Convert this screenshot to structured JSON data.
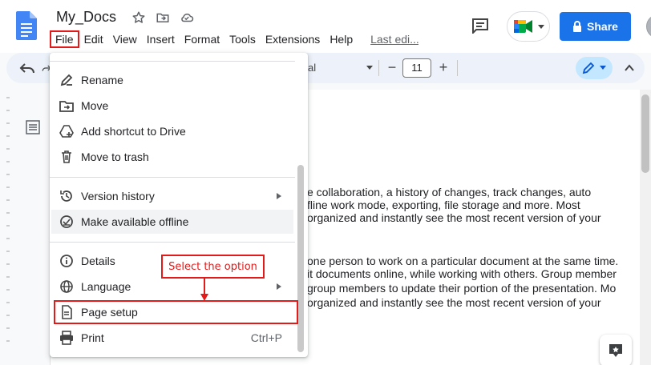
{
  "header": {
    "doc_title": "My_Docs",
    "share_label": "Share",
    "last_edit": "Last edi..."
  },
  "menubar": {
    "items": [
      "File",
      "Edit",
      "View",
      "Insert",
      "Format",
      "Tools",
      "Extensions",
      "Help"
    ]
  },
  "toolbar": {
    "font_name": "al",
    "font_size": "11",
    "minus": "−",
    "plus": "+"
  },
  "file_menu": {
    "items": [
      {
        "label": "Rename",
        "icon": "rename-icon"
      },
      {
        "label": "Move",
        "icon": "move-icon"
      },
      {
        "label": "Add shortcut to Drive",
        "icon": "add-shortcut-icon"
      },
      {
        "label": "Move to trash",
        "icon": "trash-icon"
      },
      {
        "label": "Version history",
        "icon": "history-icon",
        "submenu": true
      },
      {
        "label": "Make available offline",
        "icon": "offline-icon"
      },
      {
        "label": "Details",
        "icon": "info-icon"
      },
      {
        "label": "Language",
        "icon": "globe-icon",
        "submenu": true
      },
      {
        "label": "Page setup",
        "icon": "page-setup-icon"
      },
      {
        "label": "Print",
        "icon": "print-icon",
        "shortcut": "Ctrl+P"
      }
    ]
  },
  "document": {
    "lines": [
      "e collaboration, a history of changes, track changes, auto",
      "fline work mode, exporting, file storage and more. Most",
      "organized and instantly see the most recent version of your",
      "one person to work on a particular document at the same time.",
      "it documents online, while working with others. Group member",
      "group members to update their portion of the presentation. Mo",
      "organized and instantly see the most recent version of your"
    ]
  },
  "annotation": {
    "callout_text": "Select the option"
  },
  "colors": {
    "accent": "#1a73e8",
    "annotation": "#e21a1a",
    "toolbar_bg": "#edf2fa"
  }
}
